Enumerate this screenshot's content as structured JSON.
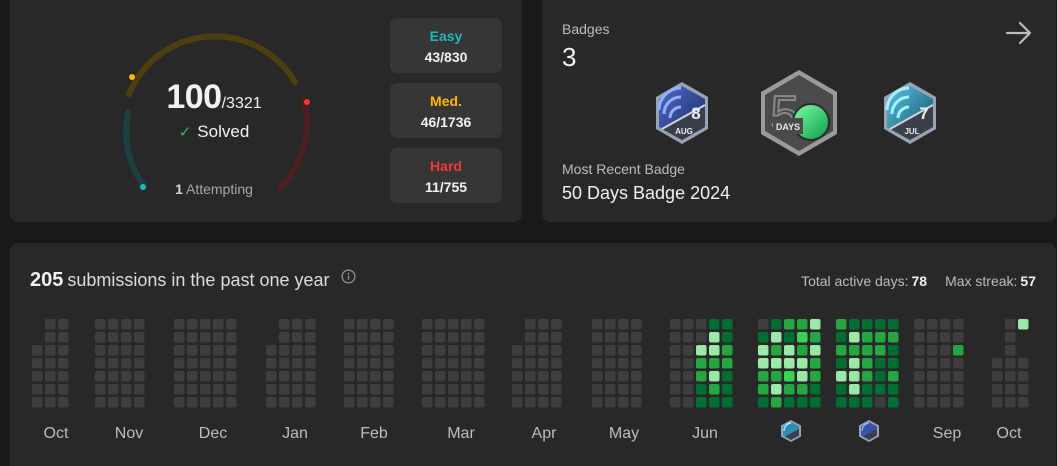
{
  "solved": {
    "count": "100",
    "total": "/3321",
    "solved_label": "Solved",
    "attempting_count": "1",
    "attempting_label": "Attempting",
    "difficulties": [
      {
        "label": "Easy",
        "value": "43/830",
        "color": "#1cbaba"
      },
      {
        "label": "Med.",
        "value": "46/1736",
        "color": "#ffb700"
      },
      {
        "label": "Hard",
        "value": "11/755",
        "color": "#f63737"
      }
    ]
  },
  "badges": {
    "title": "Badges",
    "count": "3",
    "items": [
      {
        "icon": "aug-badge-icon",
        "number": "8",
        "month": "AUG"
      },
      {
        "icon": "50-days-badge-icon",
        "number": "50",
        "label": "DAYS"
      },
      {
        "icon": "jul-badge-icon",
        "number": "7",
        "month": "JUL"
      }
    ],
    "recent_label": "Most Recent Badge",
    "recent_name": "50 Days Badge 2024"
  },
  "calendar": {
    "submissions": "205",
    "submissions_label": "submissions in the past one year",
    "active_days_label": "Total active days:",
    "active_days": "78",
    "max_streak_label": "Max streak:",
    "max_streak": "57",
    "months": [
      "Oct",
      "Nov",
      "Dec",
      "Jan",
      "Feb",
      "Mar",
      "Apr",
      "May",
      "Jun",
      "",
      "",
      "Sep",
      "Oct"
    ],
    "colors": {
      "empty": "#3e3e3e",
      "l1": "#006d32",
      "l2": "#26a641",
      "l3": "#39d353",
      "l4": "#9be9a8"
    }
  }
}
